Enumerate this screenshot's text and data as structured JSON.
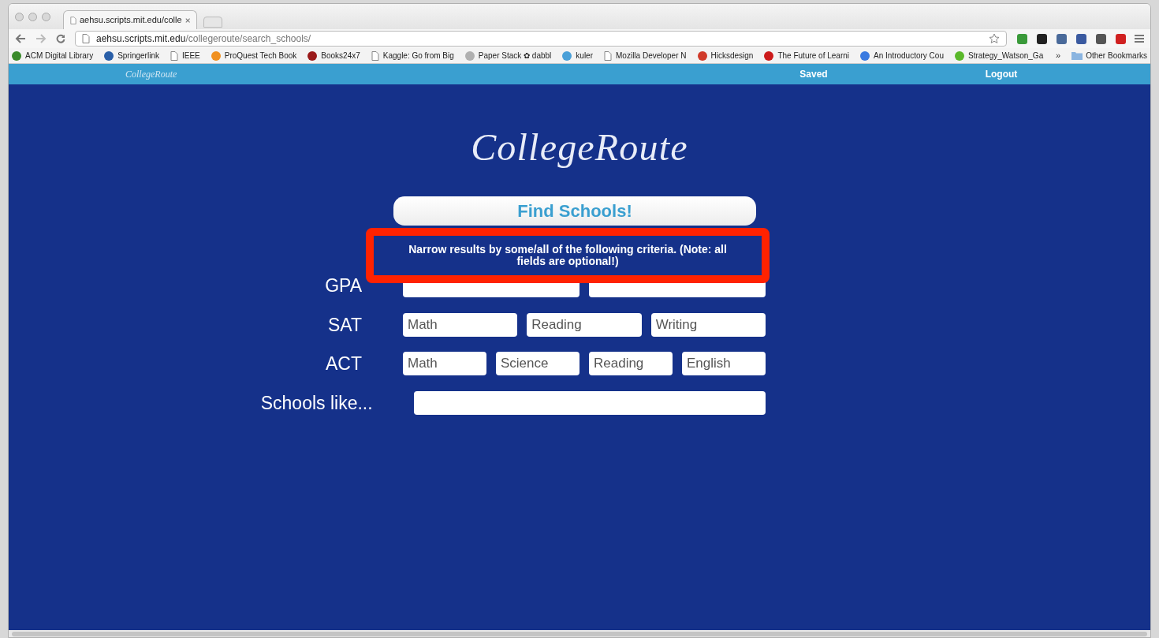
{
  "browser": {
    "tab": {
      "title": "aehsu.scripts.mit.edu/colle",
      "selected": true
    },
    "url": {
      "host": "aehsu.scripts.mit.edu",
      "path": "/collegeroute/search_schools/"
    },
    "bookmarks": [
      {
        "label": "ACM Digital Library",
        "kind": "site",
        "color": "#3a8a2a"
      },
      {
        "label": "Springerlink",
        "kind": "site",
        "color": "#2a5fa8"
      },
      {
        "label": "IEEE",
        "kind": "page"
      },
      {
        "label": "ProQuest Tech Book",
        "kind": "site",
        "color": "#f09020"
      },
      {
        "label": "Books24x7",
        "kind": "site",
        "color": "#9a1a1a"
      },
      {
        "label": "Kaggle: Go from Big",
        "kind": "page"
      },
      {
        "label": "Paper Stack ✿ dabbl",
        "kind": "site",
        "color": "#b0b0b0"
      },
      {
        "label": "kuler",
        "kind": "site",
        "color": "#4aa0d8"
      },
      {
        "label": "Mozilla Developer N",
        "kind": "page"
      },
      {
        "label": "Hicksdesign",
        "kind": "site",
        "color": "#d03a2a"
      },
      {
        "label": "The Future of Learni",
        "kind": "site",
        "color": "#cc1a1a"
      },
      {
        "label": "An Introductory Cou",
        "kind": "site",
        "color": "#3a7ae0"
      },
      {
        "label": "Strategy_Watson_Ga",
        "kind": "site",
        "color": "#5ab82a"
      }
    ],
    "overflow": "»",
    "other_bookmarks": "Other Bookmarks"
  },
  "nav": {
    "logo": "CollegeRoute",
    "links": [
      "Saved",
      "Logout"
    ]
  },
  "logo": "CollegeRoute",
  "find_button": "Find Schools!",
  "notice": "Narrow results by some/all of the following criteria. (Note: all fields are optional!)",
  "rows": [
    {
      "label": "GPA",
      "fields": [
        {
          "kind": "input"
        },
        {
          "kind": "input"
        }
      ]
    },
    {
      "label": "SAT",
      "fields": [
        {
          "kind": "input",
          "placeholder": "Math"
        },
        {
          "kind": "input",
          "placeholder": "Reading"
        },
        {
          "kind": "input",
          "placeholder": "Writing"
        }
      ]
    },
    {
      "label": "ACT",
      "fields": [
        {
          "kind": "input",
          "placeholder": "Math"
        },
        {
          "kind": "input",
          "placeholder": "Science"
        },
        {
          "kind": "input",
          "placeholder": "Reading"
        },
        {
          "kind": "input",
          "placeholder": "English"
        }
      ]
    },
    {
      "label": "Schools like...",
      "fields": [
        {
          "kind": "input"
        }
      ]
    }
  ]
}
